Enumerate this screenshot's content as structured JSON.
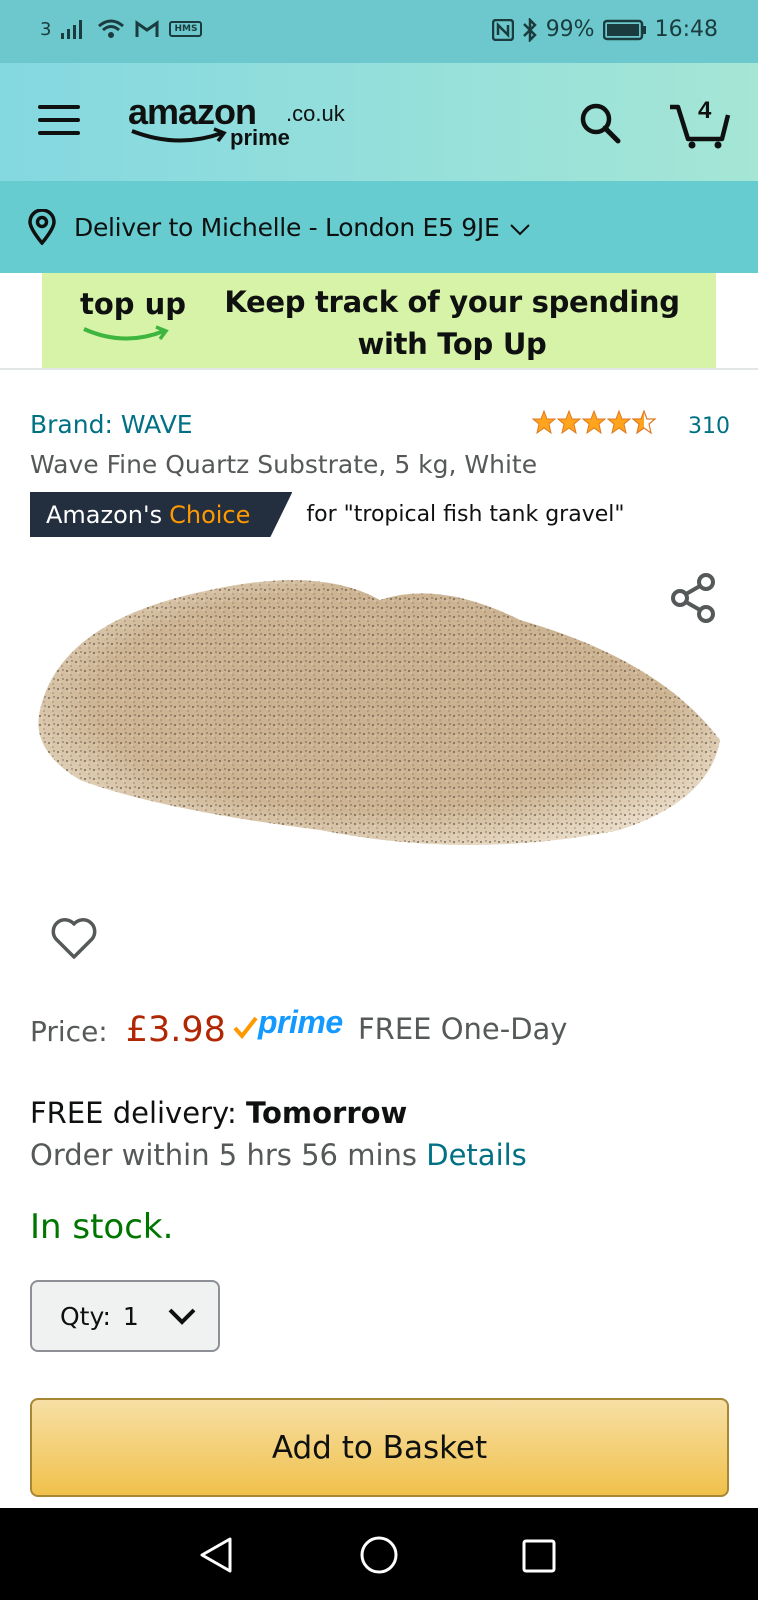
{
  "status_bar": {
    "carrier_slot": "3",
    "box_badge": "HMS",
    "battery": "99%",
    "time": "16:48"
  },
  "header": {
    "logo": {
      "word": "amazon",
      "tld": ".co.uk",
      "sub": "prime"
    },
    "cart_count": "4"
  },
  "delivery": {
    "text": "Deliver to Michelle - London E5 9JE"
  },
  "banner": {
    "logo_text": "top up",
    "message": "Keep track of your spending with Top Up"
  },
  "product": {
    "brand": "Brand: WAVE",
    "rating": 4.5,
    "rating_count": "310",
    "title": "Wave Fine Quartz Substrate, 5 kg, White",
    "choice_prefix": "Amazon's",
    "choice_word": "Choice",
    "choice_for": "for \"tropical fish tank gravel\""
  },
  "pricing": {
    "label": "Price:",
    "value": "£3.98",
    "prime_label": "prime",
    "shipping": "FREE One-Day"
  },
  "delivery_info": {
    "free_prefix": "FREE delivery:",
    "free_day": "Tomorrow",
    "order_within": "Order within 5 hrs 56 mins",
    "details_link": "Details"
  },
  "stock": "In stock.",
  "quantity": {
    "label": "Qty:",
    "value": "1"
  },
  "add_to_basket": "Add to Basket",
  "colors": {
    "accent_teal": "#007185",
    "price_red": "#b12704",
    "stock_green": "#007600",
    "prime_blue": "#1399ff",
    "button_yellow": "#f0c14b",
    "badge_navy": "#232f3e"
  },
  "icons": {
    "menu": "hamburger-icon",
    "search": "search-icon",
    "cart": "cart-icon",
    "location": "location-pin-icon",
    "share": "share-icon",
    "wishlist": "heart-icon",
    "back": "back-triangle-icon",
    "home": "home-circle-icon",
    "recent": "recent-square-icon"
  }
}
